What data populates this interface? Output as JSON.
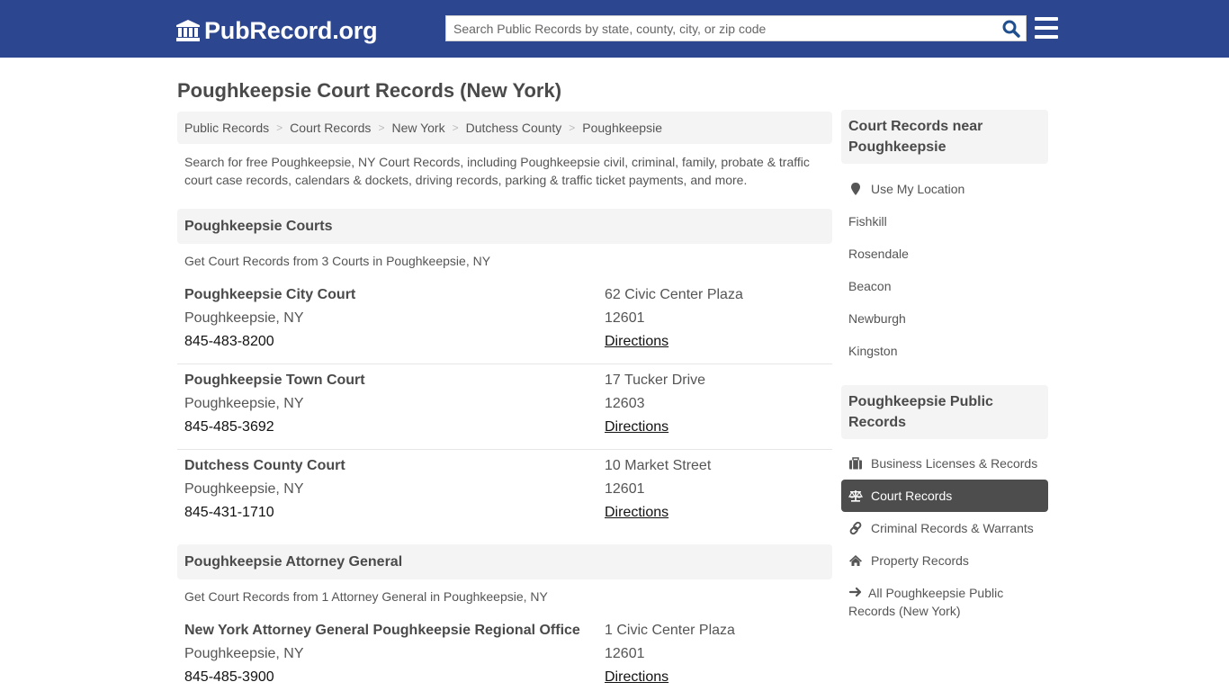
{
  "header": {
    "logo_text": "PubRecord.org",
    "search_placeholder": "Search Public Records by state, county, city, or zip code",
    "search_value": ""
  },
  "page_title": "Poughkeepsie Court Records (New York)",
  "breadcrumb": [
    {
      "label": "Public Records"
    },
    {
      "label": "Court Records"
    },
    {
      "label": "New York"
    },
    {
      "label": "Dutchess County"
    },
    {
      "label": "Poughkeepsie"
    }
  ],
  "breadcrumb_separator": ">",
  "intro": "Search for free Poughkeepsie, NY Court Records, including Poughkeepsie civil, criminal, family, probate & traffic court case records, calendars & dockets, driving records, parking & traffic ticket payments, and more.",
  "sections": [
    {
      "title": "Poughkeepsie Courts",
      "subtitle": "Get Court Records from 3 Courts in Poughkeepsie, NY",
      "entries": [
        {
          "name": "Poughkeepsie City Court",
          "city": "Poughkeepsie, NY",
          "phone": "845-483-8200",
          "address": "62 Civic Center Plaza",
          "zip": "12601",
          "directions": "Directions"
        },
        {
          "name": "Poughkeepsie Town Court",
          "city": "Poughkeepsie, NY",
          "phone": "845-485-3692",
          "address": "17 Tucker Drive",
          "zip": "12603",
          "directions": "Directions"
        },
        {
          "name": "Dutchess County Court",
          "city": "Poughkeepsie, NY",
          "phone": "845-431-1710",
          "address": "10 Market Street",
          "zip": "12601",
          "directions": "Directions"
        }
      ]
    },
    {
      "title": "Poughkeepsie Attorney General",
      "subtitle": "Get Court Records from 1 Attorney General in Poughkeepsie, NY",
      "entries": [
        {
          "name": "New York Attorney General Poughkeepsie Regional Office",
          "city": "Poughkeepsie, NY",
          "phone": "845-485-3900",
          "address": "1 Civic Center Plaza",
          "zip": "12601",
          "directions": "Directions"
        }
      ]
    }
  ],
  "sidebar": {
    "nearby": {
      "title": "Court Records near Poughkeepsie",
      "use_location": {
        "label": "Use My Location",
        "icon": "map-marker-icon"
      },
      "cities": [
        "Fishkill",
        "Rosendale",
        "Beacon",
        "Newburgh",
        "Kingston"
      ]
    },
    "public_records": {
      "title": "Poughkeepsie Public Records",
      "items": [
        {
          "label": "Business Licenses & Records",
          "icon": "briefcase-icon",
          "active": false
        },
        {
          "label": "Court Records",
          "icon": "balance-scale-icon",
          "active": true
        },
        {
          "label": "Criminal Records & Warrants",
          "icon": "link-icon",
          "active": false
        },
        {
          "label": "Property Records",
          "icon": "home-icon",
          "active": false
        },
        {
          "label": "All Poughkeepsie Public Records (New York)",
          "icon": "arrow-right-icon",
          "active": false
        }
      ]
    }
  },
  "colors": {
    "header_bg": "#2c4690",
    "search_icon": "#1f4f8f",
    "active_item_bg": "#4d4d4d",
    "panel_bg": "#f4f4f4"
  }
}
